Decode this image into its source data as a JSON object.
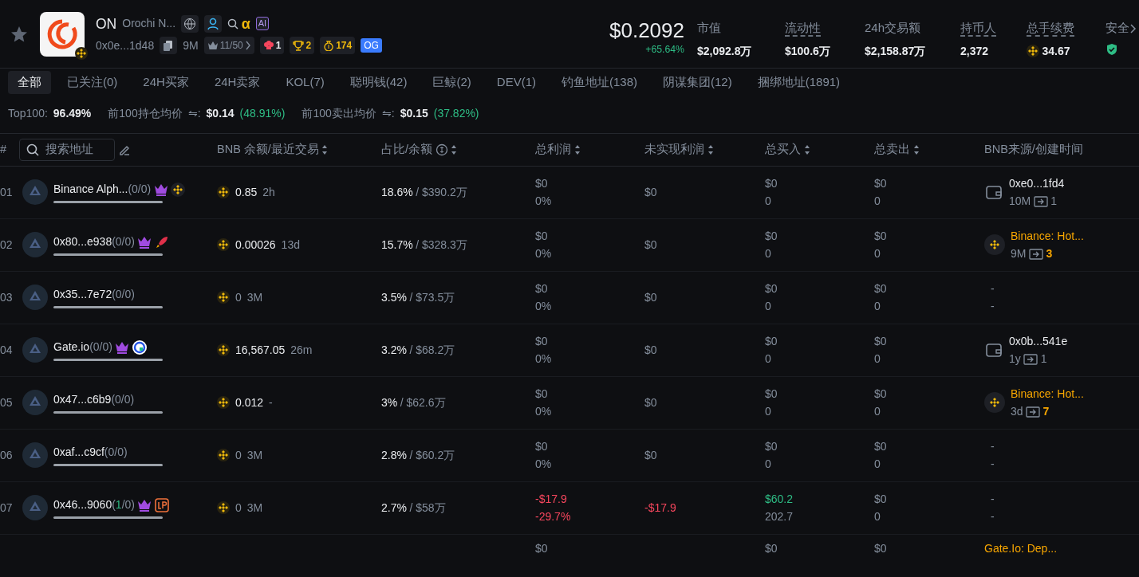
{
  "token": {
    "symbol": "ON",
    "name": "Orochi N...",
    "alpha": "α",
    "ai_badge": "AI",
    "address": "0x0e...1d48",
    "age": "9M",
    "top_ratio": "11/50",
    "chef": "1",
    "trophy": "2",
    "money": "174",
    "og": "OG"
  },
  "price": {
    "value": "$0.2092",
    "change": "+65.64%"
  },
  "stats": [
    {
      "label": "市值",
      "value": "$2,092.8万",
      "dotted": false,
      "kind": "text"
    },
    {
      "label": "流动性",
      "value": "$100.6万",
      "dotted": true,
      "kind": "text"
    },
    {
      "label": "24h交易额",
      "value": "$2,158.87万",
      "dotted": false,
      "kind": "text"
    },
    {
      "label": "持币人",
      "value": "2,372",
      "dotted": true,
      "kind": "text"
    },
    {
      "label": "总手续费",
      "value": "34.67",
      "dotted": true,
      "kind": "bnb"
    },
    {
      "label": "安全",
      "dotted": false,
      "kind": "shield"
    }
  ],
  "tabs": [
    {
      "label": "全部",
      "selected": true
    },
    {
      "label": "已关注(0)",
      "selected": false
    },
    {
      "label": "24H买家",
      "selected": false
    },
    {
      "label": "24H卖家",
      "selected": false
    },
    {
      "label": "KOL(7)",
      "selected": false
    },
    {
      "label": "聪明钱(42)",
      "selected": false
    },
    {
      "label": "巨鲸(2)",
      "selected": false
    },
    {
      "label": "DEV(1)",
      "selected": false
    },
    {
      "label": "钓鱼地址(138)",
      "selected": false
    },
    {
      "label": "阴谋集团(12)",
      "selected": false
    },
    {
      "label": "捆绑地址(1891)",
      "selected": false
    }
  ],
  "summary": [
    {
      "label": "Top100:",
      "value": "96.49%"
    },
    {
      "label": "前100持仓均价",
      "swap": "⇋:",
      "value": "$0.14",
      "change": "(48.91%)"
    },
    {
      "label": "前100卖出均价",
      "swap": "⇋:",
      "value": "$0.15",
      "change": "(37.82%)"
    }
  ],
  "table": {
    "columns": [
      {
        "label": "#",
        "kind": "rank"
      },
      {
        "label": "搜索地址",
        "kind": "search"
      },
      {
        "label": "BNB 余额/最近交易",
        "kind": "sort"
      },
      {
        "label": "占比/余额",
        "kind": "sort_coin"
      },
      {
        "label": "总利润",
        "kind": "sort"
      },
      {
        "label": "未实现利润",
        "kind": "sort"
      },
      {
        "label": "总买入",
        "kind": "sort"
      },
      {
        "label": "总卖出",
        "kind": "sort"
      },
      {
        "label": "BNB来源/创建时间",
        "kind": "plain"
      }
    ],
    "rows": [
      {
        "rank": "01",
        "address": "Binance Alph...",
        "counts": [
          {
            "text": "(0/0)",
            "active": false
          }
        ],
        "tags": [
          {
            "kind": "crown"
          },
          {
            "kind": "binance"
          }
        ],
        "bnb": "0.85",
        "last_trade": "2h",
        "share": "18.6%",
        "balance": "/ $390.2万",
        "pnl": {
          "value": "$0",
          "pct": "0%",
          "kind": "neutral"
        },
        "unrealized": {
          "value": "$0",
          "kind": "neutral"
        },
        "buy": {
          "value": "$0",
          "count": "0",
          "kind": "neutral"
        },
        "sell": {
          "value": "$0",
          "count": "0"
        },
        "source": {
          "kind": "wallet",
          "name": "0xe0...1fd4",
          "age": "10M",
          "transfers": "1"
        }
      },
      {
        "rank": "02",
        "address": "0x80...e938",
        "counts": [
          {
            "text": "(0/0)",
            "active": false
          }
        ],
        "tags": [
          {
            "kind": "crown"
          },
          {
            "kind": "rocket"
          }
        ],
        "bnb": "0.00026",
        "last_trade": "13d",
        "share": "15.7%",
        "balance": "/ $328.3万",
        "pnl": {
          "value": "$0",
          "pct": "0%",
          "kind": "neutral"
        },
        "unrealized": {
          "value": "$0",
          "kind": "neutral"
        },
        "buy": {
          "value": "$0",
          "count": "0",
          "kind": "neutral"
        },
        "sell": {
          "value": "$0",
          "count": "0"
        },
        "source": {
          "kind": "exchange",
          "name": "Binance: Hot...",
          "age": "9M",
          "transfers": "3"
        }
      },
      {
        "rank": "03",
        "address": "0x35...7e72",
        "counts": [
          {
            "text": "(0/0)",
            "active": false
          }
        ],
        "tags": [],
        "bnb": "0",
        "last_trade": "3M",
        "share": "3.5%",
        "balance": "/ $73.5万",
        "pnl": {
          "value": "$0",
          "pct": "0%",
          "kind": "neutral"
        },
        "unrealized": {
          "value": "$0",
          "kind": "neutral"
        },
        "buy": {
          "value": "$0",
          "count": "0",
          "kind": "neutral"
        },
        "sell": {
          "value": "$0",
          "count": "0"
        },
        "source": {
          "kind": "none",
          "name": "-",
          "age": "-"
        }
      },
      {
        "rank": "04",
        "address": "Gate.io",
        "counts": [
          {
            "text": "(0/0)",
            "active": false
          }
        ],
        "tags": [
          {
            "kind": "crown"
          },
          {
            "kind": "gate"
          }
        ],
        "bnb": "16,567.05",
        "last_trade": "26m",
        "share": "3.2%",
        "balance": "/ $68.2万",
        "pnl": {
          "value": "$0",
          "pct": "0%",
          "kind": "neutral"
        },
        "unrealized": {
          "value": "$0",
          "kind": "neutral"
        },
        "buy": {
          "value": "$0",
          "count": "0",
          "kind": "neutral"
        },
        "sell": {
          "value": "$0",
          "count": "0"
        },
        "source": {
          "kind": "wallet",
          "name": "0x0b...541e",
          "age": "1y",
          "transfers": "1"
        }
      },
      {
        "rank": "05",
        "address": "0x47...c6b9",
        "counts": [
          {
            "text": "(0/0)",
            "active": false
          }
        ],
        "tags": [],
        "bnb": "0.012",
        "last_trade": "-",
        "share": "3%",
        "balance": "/ $62.6万",
        "pnl": {
          "value": "$0",
          "pct": "0%",
          "kind": "neutral"
        },
        "unrealized": {
          "value": "$0",
          "kind": "neutral"
        },
        "buy": {
          "value": "$0",
          "count": "0",
          "kind": "neutral"
        },
        "sell": {
          "value": "$0",
          "count": "0"
        },
        "source": {
          "kind": "exchange",
          "name": "Binance: Hot...",
          "age": "3d",
          "transfers": "7"
        }
      },
      {
        "rank": "06",
        "address": "0xaf...c9cf",
        "counts": [
          {
            "text": "(0/0)",
            "active": false
          }
        ],
        "tags": [],
        "bnb": "0",
        "last_trade": "3M",
        "share": "2.8%",
        "balance": "/ $60.2万",
        "pnl": {
          "value": "$0",
          "pct": "0%",
          "kind": "neutral"
        },
        "unrealized": {
          "value": "$0",
          "kind": "neutral"
        },
        "buy": {
          "value": "$0",
          "count": "0",
          "kind": "neutral"
        },
        "sell": {
          "value": "$0",
          "count": "0"
        },
        "source": {
          "kind": "none",
          "name": "-",
          "age": "-"
        }
      },
      {
        "rank": "07",
        "address": "0x46...9060",
        "counts": [
          {
            "text": "(",
            "active": false
          },
          {
            "text": "1",
            "active": true
          },
          {
            "text": "/0)",
            "active": false
          }
        ],
        "tags": [
          {
            "kind": "crown"
          },
          {
            "kind": "lp"
          }
        ],
        "bnb": "0",
        "last_trade": "3M",
        "share": "2.7%",
        "balance": "/ $58万",
        "pnl": {
          "value": "-$17.9",
          "pct": "-29.7%",
          "kind": "loss"
        },
        "unrealized": {
          "value": "-$17.9",
          "kind": "loss"
        },
        "buy": {
          "value": "$60.2",
          "count": "202.7",
          "kind": "gain"
        },
        "sell": {
          "value": "$0",
          "count": "0"
        },
        "source": {
          "kind": "none",
          "name": "-",
          "age": "-"
        }
      },
      {
        "pnl": {
          "value": "$0",
          "kind": "neutral"
        },
        "buy": {
          "value": "$0",
          "kind": "neutral"
        },
        "sell": {
          "value": "$0"
        },
        "source": {
          "kind": "exchange",
          "name": "Gate.Io: Dep..."
        }
      }
    ]
  }
}
